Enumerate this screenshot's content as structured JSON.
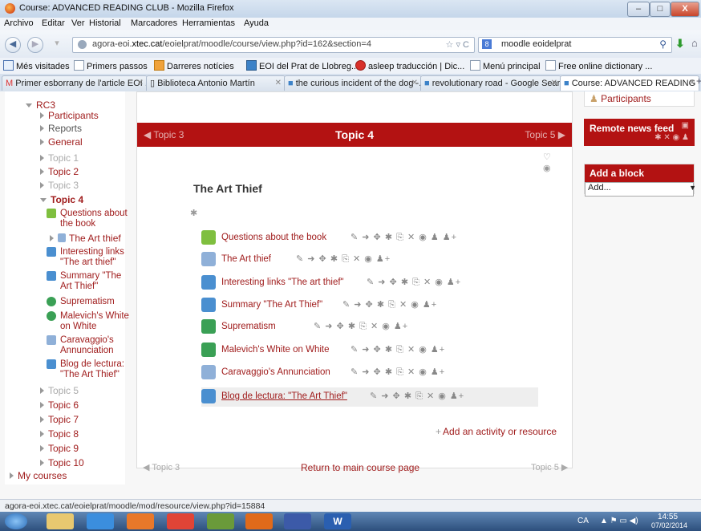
{
  "window": {
    "title": "Course: ADVANCED READING CLUB - Mozilla Firefox",
    "buttons": {
      "minimize": "–",
      "maximize": "□",
      "close": "X"
    }
  },
  "menu": [
    "Archivo",
    "Editar",
    "Ver",
    "Historial",
    "Marcadores",
    "Herramientas",
    "Ayuda"
  ],
  "navbar": {
    "url_prefix": "agora-eoi.",
    "url_domain": "xtec.cat",
    "url_path": "/eoielprat/moodle/course/view.php?id=162&section=4",
    "url_icons": "☆ ▿ C",
    "search_value": "moodle eoidelprat"
  },
  "bookmarks": [
    "Més visitades",
    "Primers passos",
    "Darreres notícies",
    "EOI del Prat de Llobreg...",
    "asleep traducción | Dic...",
    "Menú principal",
    "Free online dictionary ..."
  ],
  "tabs": [
    "Primer esborrany de l'article EOI ...",
    "Biblioteca Antonio Martín",
    "the curious incident of the dog -...",
    "revolutionary road - Google Sear...",
    "Course: ADVANCED READING C..."
  ],
  "leftnav": {
    "course": "RC3",
    "items": [
      "Participants",
      "Reports",
      "General",
      "Topic 1",
      "Topic 2",
      "Topic 3"
    ],
    "current_topic": "Topic 4",
    "resources": [
      "Questions about the book",
      "The Art thief",
      "Interesting links \"The art thief\"",
      "Summary \"The Art Thief\"",
      "Suprematism",
      "Malevich's White on White",
      "Caravaggio's Annunciation",
      "Blog de lectura: \"The Art Thief\""
    ],
    "more_topics": [
      "Topic 5",
      "Topic 6",
      "Topic 7",
      "Topic 8",
      "Topic 9",
      "Topic 10"
    ],
    "my_courses": "My courses"
  },
  "main": {
    "prev_topic": "◀ Topic 3",
    "current_topic": "Topic 4",
    "next_topic": "Topic 5 ▶",
    "section_title": "The Art Thief",
    "activities": [
      {
        "name": "Questions about the book",
        "icon_color": "#7fbf3f",
        "edit": "✎ ➜ ✥ ✱ ⎘ ✕ ◉ ♟ ♟+"
      },
      {
        "name": "The Art thief",
        "icon_color": "#8fb0d8",
        "edit": "✎ ➜ ✥ ✱ ⎘ ✕ ◉ ♟+"
      },
      {
        "name": "Interesting links \"The art thief\"",
        "icon_color": "#4a8fd0",
        "edit": "✎ ➜ ✥ ✱ ⎘ ✕ ◉ ♟+"
      },
      {
        "name": "Summary \"The Art Thief\"",
        "icon_color": "#4a8fd0",
        "edit": "✎ ➜ ✥ ✱ ⎘ ✕ ◉ ♟+"
      },
      {
        "name": "Suprematism",
        "icon_color": "#3aa055",
        "edit": "✎ ➜ ✥ ✱ ⎘ ✕ ◉ ♟+"
      },
      {
        "name": "Malevich's White on White",
        "icon_color": "#3aa055",
        "edit": "✎ ➜ ✥ ✱ ⎘ ✕ ◉ ♟+"
      },
      {
        "name": "Caravaggio's Annunciation",
        "icon_color": "#8fb0d8",
        "edit": "✎ ➜ ✥ ✱ ⎘ ✕ ◉ ♟+"
      },
      {
        "name": "Blog de lectura: \"The Art Thief\"",
        "icon_color": "#4a8fd0",
        "edit": "✎ ➜ ✥ ✱ ⎘ ✕ ◉ ♟+"
      }
    ],
    "add_activity": "Add an activity or resource",
    "bottom_prev": "◀ Topic 3",
    "return_link": "Return to main course page",
    "bottom_next": "Topic 5 ▶"
  },
  "right": {
    "participants": "Participants",
    "news_feed": "Remote news feed",
    "news_icons": "✱ ✕ ◉ ♟",
    "add_block": "Add a block",
    "add_select": "Add..."
  },
  "status": "agora-eoi.xtec.cat/eoielprat/moodle/mod/resource/view.php?id=15884",
  "tray": {
    "lang": "CA",
    "time": "14:55",
    "date": "07/02/2014"
  },
  "colors": {
    "accent": "#b31212",
    "link": "#a01d1d"
  }
}
